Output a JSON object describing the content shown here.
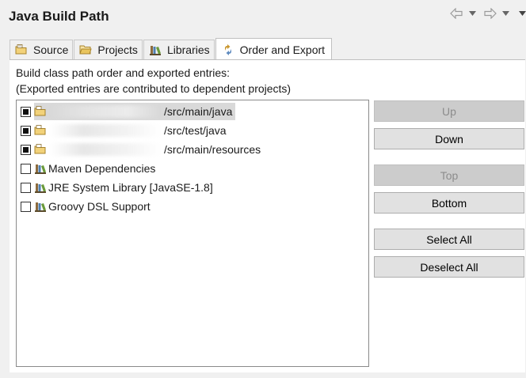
{
  "page": {
    "title": "Java Build Path"
  },
  "tabs": [
    {
      "label": "Source",
      "icon": "source-folder-icon",
      "active": false
    },
    {
      "label": "Projects",
      "icon": "open-folder-icon",
      "active": false
    },
    {
      "label": "Libraries",
      "icon": "library-icon",
      "active": false
    },
    {
      "label": "Order and Export",
      "icon": "order-export-icon",
      "active": true
    }
  ],
  "description": {
    "line1": "Build class path order and exported entries:",
    "line2": "(Exported entries are contributed to dependent projects)"
  },
  "entries": [
    {
      "label": "/src/main/java",
      "checked": true,
      "selected": true,
      "icon": "source-folder-icon"
    },
    {
      "label": "/src/test/java",
      "checked": true,
      "selected": false,
      "icon": "source-folder-icon"
    },
    {
      "label": "/src/main/resources",
      "checked": true,
      "selected": false,
      "icon": "source-folder-icon"
    },
    {
      "label": "Maven Dependencies",
      "checked": false,
      "selected": false,
      "icon": "library-icon"
    },
    {
      "label": "JRE System Library [JavaSE-1.8]",
      "checked": false,
      "selected": false,
      "icon": "library-icon"
    },
    {
      "label": "Groovy DSL Support",
      "checked": false,
      "selected": false,
      "icon": "library-icon"
    }
  ],
  "buttons": {
    "up": "Up",
    "down": "Down",
    "top": "Top",
    "bottom": "Bottom",
    "select_all": "Select All",
    "deselect_all": "Deselect All"
  },
  "colors": {
    "background": "#f0f0f0",
    "selection": "#d9d9d9",
    "button_face": "#e1e1e1",
    "button_disabled": "#cccccc"
  }
}
